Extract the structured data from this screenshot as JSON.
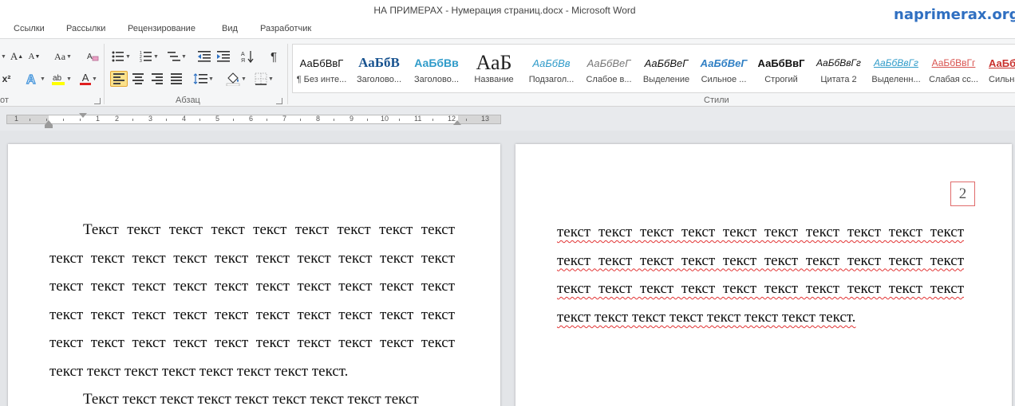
{
  "titlebar": {
    "title": "НА ПРИМЕРАХ - Нумерация страниц.docx -  Microsoft Word",
    "watermark": "naprimerax.org"
  },
  "tabs": [
    "Ссылки",
    "Рассылки",
    "Рецензирование",
    "Вид",
    "Разработчик"
  ],
  "ribbon": {
    "groups": {
      "font_partial": "от",
      "paragraph": "Абзац",
      "styles": "Стили"
    },
    "buttons": {
      "grow_font": "A",
      "shrink_font": "A",
      "change_case": "Aa",
      "superscript": "x²",
      "font_color": "A",
      "pilcrow": "¶"
    },
    "styles": [
      {
        "sample": "АаБбВвГ",
        "name": "¶ Без инте..."
      },
      {
        "sample": "АаБбВ",
        "name": "Заголово..."
      },
      {
        "sample": "АаБбВв",
        "name": "Заголово..."
      },
      {
        "sample": "АаБ",
        "name": "Название"
      },
      {
        "sample": "АаБбВв",
        "name": "Подзагол..."
      },
      {
        "sample": "АаБбВеГ",
        "name": "Слабое в..."
      },
      {
        "sample": "АаБбВеГ",
        "name": "Выделение"
      },
      {
        "sample": "АаБбВеГ",
        "name": "Сильное ..."
      },
      {
        "sample": "АаБбВвГ",
        "name": "Строгий"
      },
      {
        "sample": "АаБбВвГг",
        "name": "Цитата 2"
      },
      {
        "sample": "АаБбВвГг",
        "name": "Выделенн..."
      },
      {
        "sample": "АаБбВвГг",
        "name": "Слабая сс..."
      },
      {
        "sample": "АаБб",
        "name": "Сильна"
      }
    ]
  },
  "ruler": {
    "numbers": [
      "1",
      "1",
      "2",
      "3",
      "4",
      "5",
      "6",
      "7",
      "8",
      "9",
      "10",
      "11",
      "12",
      "13"
    ]
  },
  "document": {
    "page1": {
      "paragraph1": "Текст текст текст текст текст текст текст текст текст текст текст текст текст текст текст текст текст текст текст текст текст текст текст текст текст текст текст текст текст текст текст текст текст текст текст текст текст текст текст текст текст текст текст текст текст текст текст текст текст текст текст текст текст текст текст текст текст.",
      "paragraph2": "Текст текст текст текст текст текст текст текст текст"
    },
    "page2": {
      "page_number": "2",
      "paragraph1": "текст текст текст текст текст текст текст текст текст текст текст текст текст текст текст текст текст текст текст текст текст текст текст текст текст текст текст текст текст текст текст текст текст текст текст текст текст текст."
    }
  },
  "colors": {
    "accent_watermark": "#2f6fc1",
    "active_button": "#fbe18b",
    "spell_underline": "#e23434",
    "page_number_box": "#e06b6b"
  }
}
